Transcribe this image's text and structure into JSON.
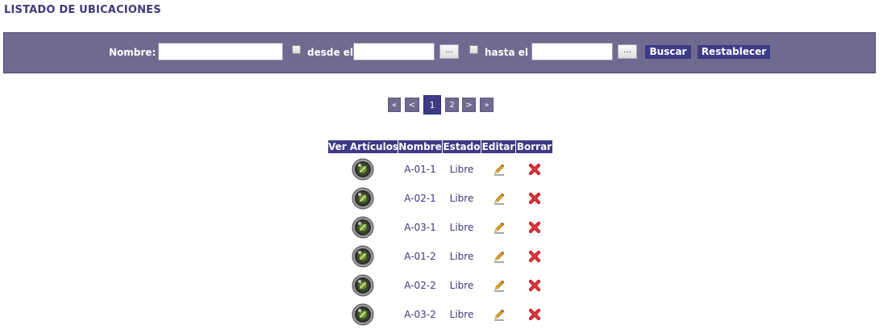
{
  "page": {
    "title": "LISTADO DE UBICACIONES"
  },
  "search": {
    "name_label": "Nombre:",
    "name_value": "",
    "from_label": "desde el",
    "from_value": "",
    "from_picker": "...",
    "to_label": "hasta el",
    "to_value": "",
    "to_picker": "...",
    "search_button": "Buscar",
    "reset_button": "Restablecer"
  },
  "pagination": {
    "first": "«",
    "prev": "<",
    "pages": [
      "1",
      "2"
    ],
    "current": "1",
    "next": ">",
    "last": "»"
  },
  "table": {
    "headers": [
      "Ver Artículos",
      "Nombre",
      "Estado",
      "Editar",
      "Borrar"
    ],
    "rows": [
      {
        "nombre": "A-01-1",
        "estado": "Libre"
      },
      {
        "nombre": "A-02-1",
        "estado": "Libre"
      },
      {
        "nombre": "A-03-1",
        "estado": "Libre"
      },
      {
        "nombre": "A-01-2",
        "estado": "Libre"
      },
      {
        "nombre": "A-02-2",
        "estado": "Libre"
      },
      {
        "nombre": "A-03-2",
        "estado": "Libre"
      }
    ]
  },
  "icons": {
    "view": "magnifier-view-icon",
    "edit": "pencil-icon",
    "delete": "red-x-icon"
  },
  "colors": {
    "accent": "#3d3a86",
    "bar": "#6f6a8f",
    "text": "#3d3a7c",
    "delete": "#d9262c"
  }
}
